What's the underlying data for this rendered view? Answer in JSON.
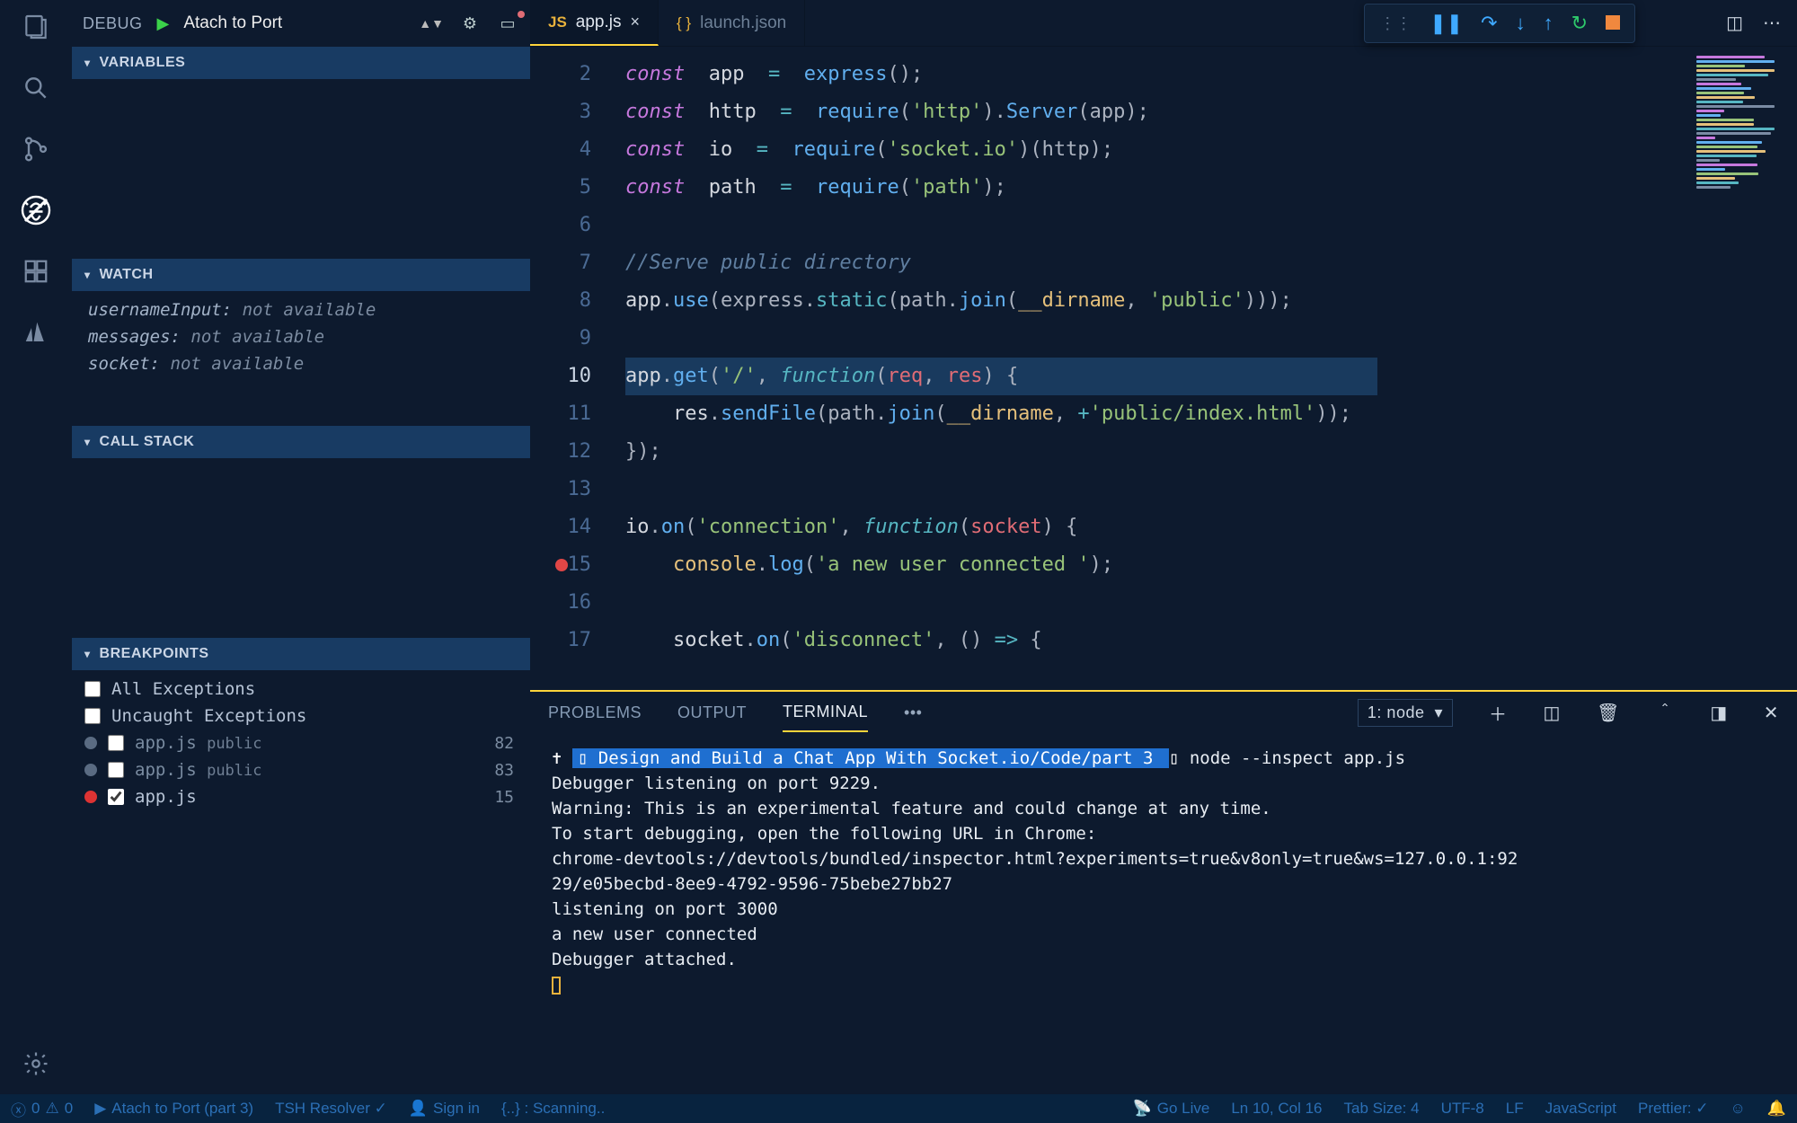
{
  "activity": {
    "icons": [
      "files",
      "search",
      "scm",
      "debug",
      "extensions",
      "azure"
    ]
  },
  "debugHeader": {
    "label": "DEBUG",
    "config": "Atach to Port"
  },
  "sections": {
    "variables": "VARIABLES",
    "watch": "WATCH",
    "callstack": "CALL STACK",
    "breakpoints": "BREAKPOINTS"
  },
  "watch": [
    {
      "name": "usernameInput:",
      "value": "not available"
    },
    {
      "name": "messages:",
      "value": "not available"
    },
    {
      "name": "socket:",
      "value": "not available"
    }
  ],
  "breakpoints": [
    {
      "kind": "exc",
      "label": "All Exceptions",
      "checked": false
    },
    {
      "kind": "exc",
      "label": "Uncaught Exceptions",
      "checked": false
    },
    {
      "kind": "file",
      "label": "app.js",
      "sub": "public",
      "line": "82",
      "checked": false,
      "active": false
    },
    {
      "kind": "file",
      "label": "app.js",
      "sub": "public",
      "line": "83",
      "checked": false,
      "active": false
    },
    {
      "kind": "file",
      "label": "app.js",
      "sub": "",
      "line": "15",
      "checked": true,
      "active": true
    }
  ],
  "tabs": [
    {
      "icon": "JS",
      "name": "app.js",
      "active": true,
      "dirty": false
    },
    {
      "icon": "{}",
      "name": "launch.json",
      "active": false,
      "dirty": false
    }
  ],
  "code": {
    "first_line": 2,
    "current_line": 10,
    "breakpoint_lines": [
      15
    ],
    "lines": [
      [
        [
          "kw",
          "const"
        ],
        [
          "",
          ""
        ],
        [
          "ident",
          "app"
        ],
        [
          "",
          ""
        ],
        [
          "op",
          "="
        ],
        [
          "",
          ""
        ],
        [
          "fn",
          "express"
        ],
        [
          "punc",
          "();"
        ]
      ],
      [
        [
          "kw",
          "const"
        ],
        [
          "",
          ""
        ],
        [
          "ident",
          "http"
        ],
        [
          "",
          ""
        ],
        [
          "op",
          "="
        ],
        [
          "",
          ""
        ],
        [
          "fn",
          "require"
        ],
        [
          "punc",
          "("
        ],
        [
          "str",
          "'http'"
        ],
        [
          "punc",
          ")."
        ],
        [
          "fn",
          "Server"
        ],
        [
          "punc",
          "(app);"
        ]
      ],
      [
        [
          "kw",
          "const"
        ],
        [
          "",
          ""
        ],
        [
          "ident",
          "io"
        ],
        [
          "",
          ""
        ],
        [
          "op",
          "="
        ],
        [
          "",
          ""
        ],
        [
          "fn",
          "require"
        ],
        [
          "punc",
          "("
        ],
        [
          "str",
          "'socket.io'"
        ],
        [
          "punc",
          ")(http);"
        ]
      ],
      [
        [
          "kw",
          "const"
        ],
        [
          "",
          ""
        ],
        [
          "ident",
          "path"
        ],
        [
          "",
          ""
        ],
        [
          "op",
          "="
        ],
        [
          "",
          ""
        ],
        [
          "fn",
          "require"
        ],
        [
          "punc",
          "("
        ],
        [
          "str",
          "'path'"
        ],
        [
          "punc",
          ");"
        ]
      ],
      [],
      [
        [
          "cmt",
          "//Serve public directory"
        ]
      ],
      [
        [
          "ident",
          "app"
        ],
        [
          "punc",
          "."
        ],
        [
          "fn",
          "use"
        ],
        [
          "punc",
          "(express."
        ],
        [
          "sfn",
          "static"
        ],
        [
          "punc",
          "(path."
        ],
        [
          "fn",
          "join"
        ],
        [
          "punc",
          "("
        ],
        [
          "varl",
          "__dirname"
        ],
        [
          "punc",
          ", "
        ],
        [
          "str",
          "'public'"
        ],
        [
          "punc",
          ")));"
        ]
      ],
      [],
      [
        [
          "ident",
          "app"
        ],
        [
          "punc",
          "."
        ],
        [
          "fn",
          "get"
        ],
        [
          "punc",
          "("
        ],
        [
          "str",
          "'/'"
        ],
        [
          "punc",
          ", "
        ],
        [
          "kw2",
          "function"
        ],
        [
          "punc",
          "("
        ],
        [
          "var",
          "req"
        ],
        [
          "punc",
          ", "
        ],
        [
          "var",
          "res"
        ],
        [
          "punc",
          ") {"
        ]
      ],
      [
        [
          "",
          "    "
        ],
        [
          "ident",
          "res"
        ],
        [
          "punc",
          "."
        ],
        [
          "fn",
          "sendFile"
        ],
        [
          "punc",
          "(path."
        ],
        [
          "fn",
          "join"
        ],
        [
          "punc",
          "("
        ],
        [
          "varl",
          "__dirname"
        ],
        [
          "punc",
          ", "
        ],
        [
          "op",
          "+"
        ],
        [
          "str",
          "'public/index.html'"
        ],
        [
          "punc",
          "));"
        ]
      ],
      [
        [
          "punc",
          "});"
        ]
      ],
      [],
      [
        [
          "ident",
          "io"
        ],
        [
          "punc",
          "."
        ],
        [
          "fn",
          "on"
        ],
        [
          "punc",
          "("
        ],
        [
          "str",
          "'connection'"
        ],
        [
          "punc",
          ", "
        ],
        [
          "kw2",
          "function"
        ],
        [
          "punc",
          "("
        ],
        [
          "var",
          "socket"
        ],
        [
          "punc",
          ") {"
        ]
      ],
      [
        [
          "",
          "    "
        ],
        [
          "varl",
          "console"
        ],
        [
          "punc",
          "."
        ],
        [
          "fn",
          "log"
        ],
        [
          "punc",
          "("
        ],
        [
          "str",
          "'a new user connected '"
        ],
        [
          "punc",
          ");"
        ]
      ],
      [],
      [
        [
          "",
          "    "
        ],
        [
          "ident",
          "socket"
        ],
        [
          "punc",
          "."
        ],
        [
          "fn",
          "on"
        ],
        [
          "punc",
          "("
        ],
        [
          "str",
          "'disconnect'"
        ],
        [
          "punc",
          ", () "
        ],
        [
          "op",
          "=>"
        ],
        [
          "punc",
          " {"
        ]
      ]
    ]
  },
  "panel": {
    "tabs": [
      "PROBLEMS",
      "OUTPUT",
      "TERMINAL"
    ],
    "active": "TERMINAL",
    "terminal_name": "1: node",
    "path": "Design and Build a Chat App With Socket.io/Code/part 3",
    "command": "node --inspect app.js",
    "lines": [
      "Debugger listening on port 9229.",
      "Warning: This is an experimental feature and could change at any time.",
      "To start debugging, open the following URL in Chrome:",
      "    chrome-devtools://devtools/bundled/inspector.html?experiments=true&v8only=true&ws=127.0.0.1:92",
      "29/e05becbd-8ee9-4792-9596-75bebe27bb27",
      "listening on port 3000",
      "a new user connected",
      "Debugger attached."
    ]
  },
  "status": {
    "errors": "0",
    "warnings": "0",
    "debug_label": "Atach to Port (part 3)",
    "resolver": "TSH Resolver ✓",
    "signin": "Sign in",
    "scanning": "{..} : Scanning..",
    "golive": "Go Live",
    "pos": "Ln 10, Col 16",
    "tabsize": "Tab Size: 4",
    "encoding": "UTF-8",
    "eol": "LF",
    "lang": "JavaScript",
    "prettier": "Prettier: ✓"
  }
}
